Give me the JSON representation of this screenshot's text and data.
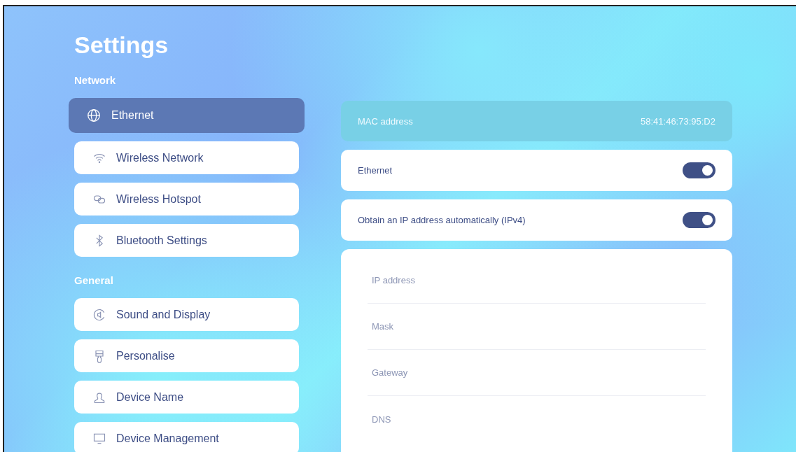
{
  "title": "Settings",
  "sections": [
    {
      "heading": "Network",
      "items": [
        {
          "label": "Ethernet",
          "kind": "globe",
          "selected": true
        },
        {
          "label": "Wireless Network",
          "kind": "wifi",
          "selected": false
        },
        {
          "label": "Wireless Hotspot",
          "kind": "link",
          "selected": false
        },
        {
          "label": "Bluetooth Settings",
          "kind": "bluetooth",
          "selected": false
        }
      ]
    },
    {
      "heading": "General",
      "items": [
        {
          "label": "Sound and Display",
          "kind": "speaker",
          "selected": false
        },
        {
          "label": "Personalise",
          "kind": "brush",
          "selected": false
        },
        {
          "label": "Device Name",
          "kind": "person",
          "selected": false
        },
        {
          "label": "Device Management",
          "kind": "monitor",
          "selected": false
        }
      ]
    }
  ],
  "mac": {
    "label": "MAC address",
    "value": "58:41:46:73:95:D2"
  },
  "toggles": [
    {
      "label": "Ethernet",
      "on": true
    },
    {
      "label": "Obtain an IP address automatically (IPv4)",
      "on": true
    }
  ],
  "fields": [
    {
      "placeholder": "IP address"
    },
    {
      "placeholder": "Mask"
    },
    {
      "placeholder": "Gateway"
    },
    {
      "placeholder": "DNS"
    }
  ]
}
